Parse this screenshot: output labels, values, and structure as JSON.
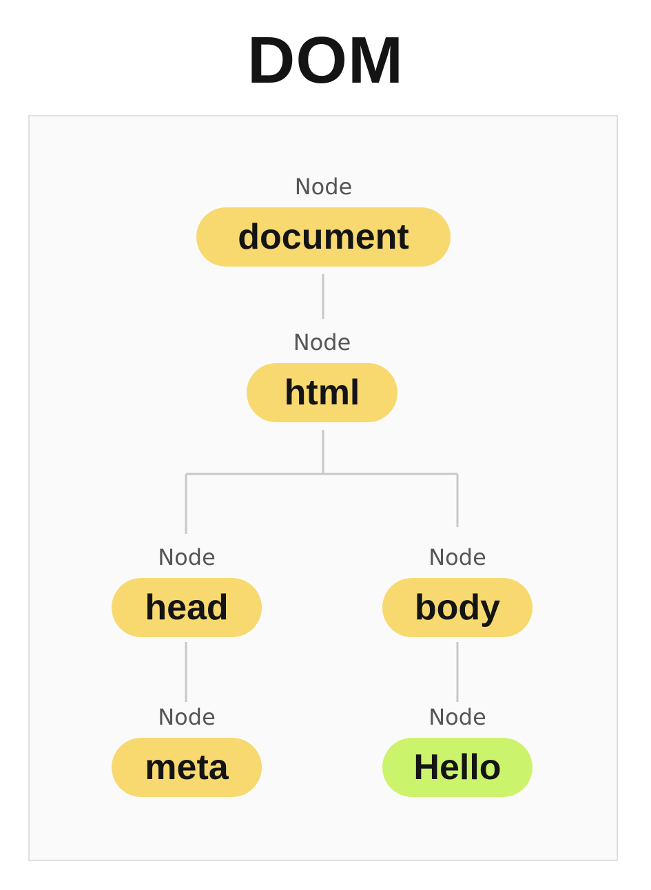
{
  "title": "DOM",
  "colors": {
    "element_node": "#f7d96f",
    "text_node": "#ccf36c",
    "connector": "#c8c8c8",
    "panel_background": "#fafafa",
    "panel_border": "#e0e0e0"
  },
  "nodes": {
    "document": {
      "type": "Node",
      "label": "document",
      "kind": "element"
    },
    "html": {
      "type": "Node",
      "label": "html",
      "kind": "element"
    },
    "head": {
      "type": "Node",
      "label": "head",
      "kind": "element"
    },
    "body": {
      "type": "Node",
      "label": "body",
      "kind": "element"
    },
    "meta": {
      "type": "Node",
      "label": "meta",
      "kind": "element"
    },
    "hello": {
      "type": "Node",
      "label": "Hello",
      "kind": "text"
    }
  },
  "edges": [
    [
      "document",
      "html"
    ],
    [
      "html",
      "head"
    ],
    [
      "html",
      "body"
    ],
    [
      "head",
      "meta"
    ],
    [
      "body",
      "hello"
    ]
  ]
}
